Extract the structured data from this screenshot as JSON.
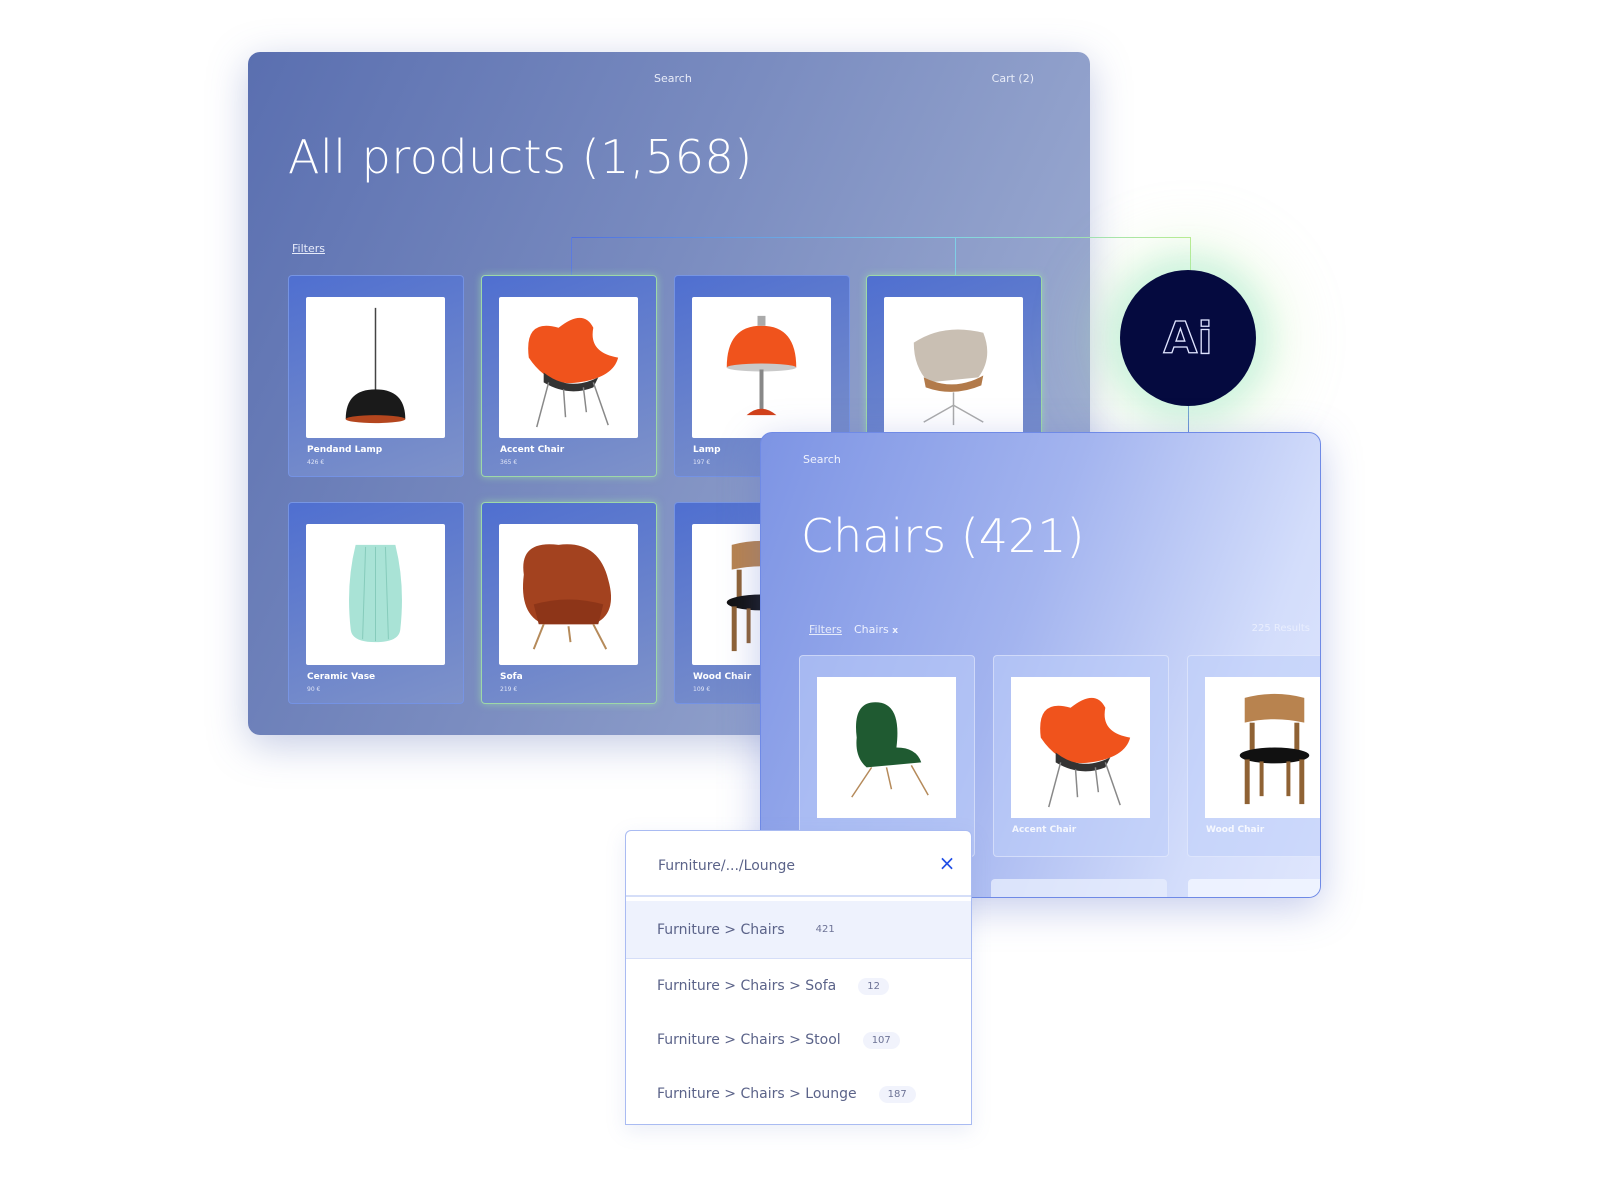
{
  "main_window": {
    "search_label": "Search",
    "cart_label": "Cart (2)",
    "title": "All products (1,568)",
    "filters_label": "Filters",
    "products": [
      {
        "name": "Pendand Lamp",
        "price": "426 €",
        "icon": "pendant-lamp"
      },
      {
        "name": "Accent Chair",
        "price": "365 €",
        "icon": "orange-chair"
      },
      {
        "name": "Lamp",
        "price": "197 €",
        "icon": "orange-lamp"
      },
      {
        "name": "",
        "price": "",
        "icon": "grey-swivel-chair"
      },
      {
        "name": "Ceramic Vase",
        "price": "90 €",
        "icon": "vase"
      },
      {
        "name": "Sofa",
        "price": "219 €",
        "icon": "rust-armchair"
      },
      {
        "name": "Wood Chair",
        "price": "109 €",
        "icon": "wood-chair"
      }
    ]
  },
  "ai_badge": {
    "label": "Ai"
  },
  "chairs_window": {
    "search_label": "Search",
    "title": "Chairs (421)",
    "filters_label": "Filters",
    "chip_label": "Chairs",
    "chip_remove": "x",
    "results_label": "225 Results",
    "products": [
      {
        "name": "",
        "icon": "green-chair"
      },
      {
        "name": "Accent Chair",
        "icon": "orange-chair"
      },
      {
        "name": "Wood Chair",
        "icon": "wood-chair"
      }
    ]
  },
  "category_dropdown": {
    "query": "Furniture/.../Lounge",
    "close_icon": "×",
    "items": [
      {
        "label": "Furniture > Chairs",
        "count": "421"
      },
      {
        "label": "Furniture > Chairs > Sofa",
        "count": "12"
      },
      {
        "label": "Furniture > Chairs > Stool",
        "count": "107"
      },
      {
        "label": "Furniture > Chairs > Lounge",
        "count": "187"
      }
    ]
  },
  "colors": {
    "accent": "#1f4ee6",
    "ai_badge": "#050a3f",
    "panel": "#6f85c4"
  }
}
